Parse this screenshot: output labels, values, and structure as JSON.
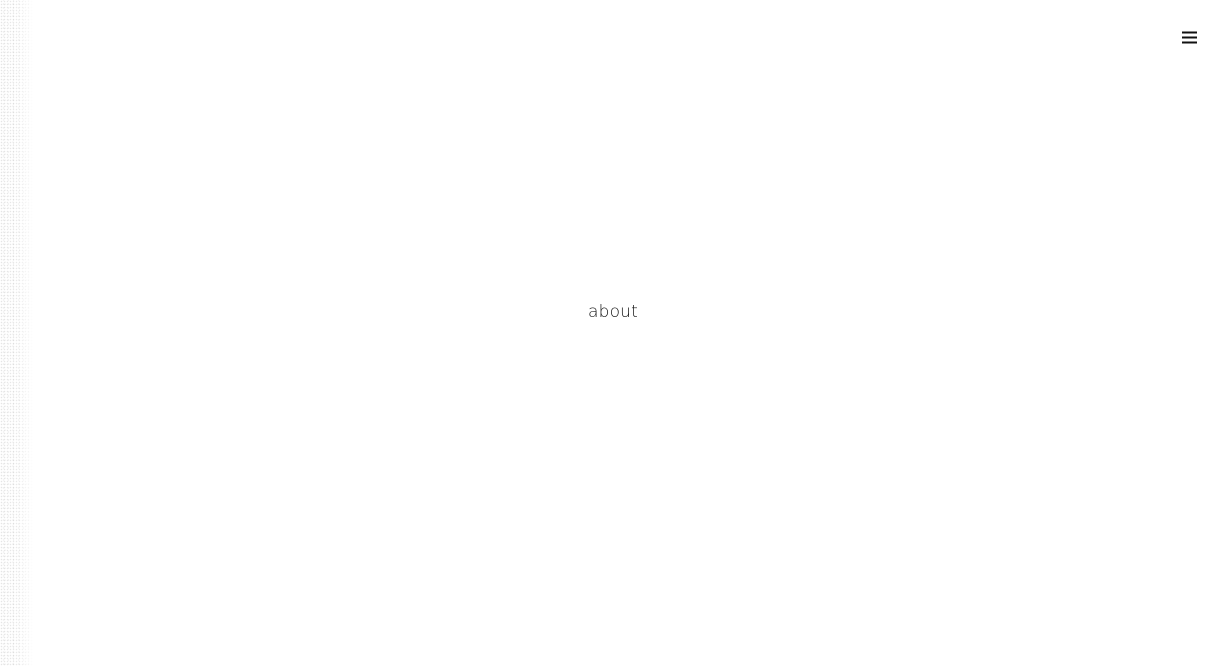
{
  "header": {
    "menu_icon": "hamburger-menu-icon"
  },
  "main": {
    "center_link_label": "about"
  },
  "colors": {
    "background": "#ffffff",
    "text": "#151515"
  }
}
